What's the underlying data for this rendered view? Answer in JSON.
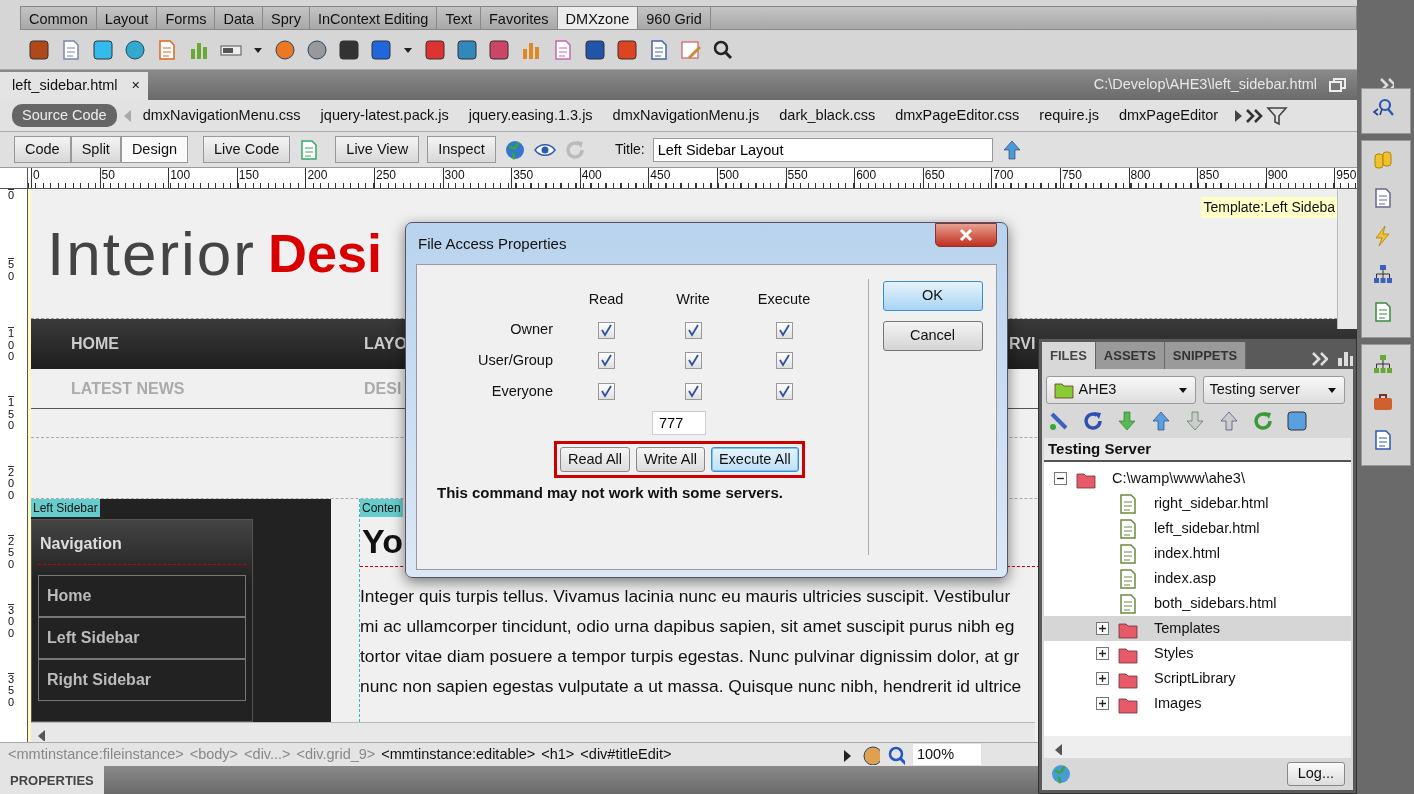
{
  "insert_tabs": [
    {
      "label": "Common",
      "selected": false
    },
    {
      "label": "Layout",
      "selected": false
    },
    {
      "label": "Forms",
      "selected": false
    },
    {
      "label": "Data",
      "selected": false
    },
    {
      "label": "Spry",
      "selected": false
    },
    {
      "label": "InContext Editing",
      "selected": false
    },
    {
      "label": "Text",
      "selected": false
    },
    {
      "label": "Favorites",
      "selected": false
    },
    {
      "label": "DMXzone",
      "selected": true
    },
    {
      "label": "960 Grid",
      "selected": false
    }
  ],
  "document_tab": {
    "label": "left_sidebar.html",
    "close": "×"
  },
  "document_path": "C:\\Develop\\AHE3\\left_sidebar.html",
  "related_files": [
    {
      "label": "Source Code",
      "selected": true
    },
    {
      "label": "dmxNavigationMenu.css",
      "selected": false
    },
    {
      "label": "jquery-latest.pack.js",
      "selected": false
    },
    {
      "label": "jquery.easing.1.3.js",
      "selected": false
    },
    {
      "label": "dmxNavigationMenu.js",
      "selected": false
    },
    {
      "label": "dark_black.css",
      "selected": false
    },
    {
      "label": "dmxPageEditor.css",
      "selected": false
    },
    {
      "label": "require.js",
      "selected": false
    },
    {
      "label": "dmxPageEditor",
      "selected": false
    }
  ],
  "view_buttons": [
    {
      "label": "Code",
      "selected": false
    },
    {
      "label": "Split",
      "selected": false
    },
    {
      "label": "Design",
      "selected": true
    }
  ],
  "live_code_button": "Live Code",
  "live_buttons": [
    "Live View",
    "Inspect"
  ],
  "title_field": {
    "label": "Title:",
    "value": "Left Sidebar Layout"
  },
  "horizontal_ruler": [
    "0",
    "50",
    "100",
    "150",
    "200",
    "250",
    "300",
    "350",
    "400",
    "450",
    "500",
    "550",
    "600",
    "650",
    "700",
    "750",
    "800",
    "850",
    "900",
    "950"
  ],
  "vertical_ruler": [
    "0",
    "50",
    "100",
    "150",
    "200",
    "250",
    "300",
    "350"
  ],
  "page": {
    "logo_light": "Interior",
    "logo_bold": "Desi",
    "template_label": "Template:Left Sideba",
    "nav": [
      "HOME",
      "LAYO",
      "RVI"
    ],
    "subnav": [
      "LATEST NEWS",
      "DESI"
    ],
    "sidebar_label": "Left Sidebar",
    "sidebar_title": "Navigation",
    "sidebar_links": [
      "Home",
      "Left Sidebar",
      "Right Sidebar"
    ],
    "content_label": "Conten",
    "heading": "Yo",
    "paragraph_lines": [
      "Integer quis turpis tellus. Vivamus lacinia nunc eu mauris ultricies suscipit. Vestibulur",
      "mi ac ullamcorper tincidunt, odio urna dapibus sapien, sit amet suscipit purus nibh eg",
      "tortor vitae diam posuere a tempor turpis egestas. Nunc pulvinar dignissim dolor, at gr",
      "nunc non sapien egestas vulputate a ut massa. Quisque nunc nibh, hendrerit id ultrice"
    ]
  },
  "tag_selector": [
    {
      "label": "<mmtinstance:fileinstance>",
      "dimmed": true
    },
    {
      "label": "<body>",
      "dimmed": true
    },
    {
      "label": "<div...>",
      "dimmed": true
    },
    {
      "label": "<div.grid_9>",
      "dimmed": true
    },
    {
      "label": "<mmtinstance:editable>",
      "dimmed": false
    },
    {
      "label": "<h1>",
      "dimmed": false
    },
    {
      "label": "<div#titleEdit>",
      "dimmed": false
    }
  ],
  "zoom": "100%",
  "properties_tab": "PROPERTIES",
  "dialog": {
    "title": "File Access Properties",
    "columns": [
      "Read",
      "Write",
      "Execute"
    ],
    "rows": [
      {
        "label": "Owner",
        "cells": [
          {
            "checked": true
          },
          {
            "checked": true
          },
          {
            "checked": true
          }
        ]
      },
      {
        "label": "User/Group",
        "cells": [
          {
            "checked": true
          },
          {
            "checked": true
          },
          {
            "checked": true
          }
        ]
      },
      {
        "label": "Everyone",
        "cells": [
          {
            "checked": true
          },
          {
            "checked": true
          },
          {
            "checked": true
          }
        ]
      }
    ],
    "octal": "777",
    "all_buttons": [
      {
        "label": "Read All",
        "focused": false
      },
      {
        "label": "Write All",
        "focused": false
      },
      {
        "label": "Execute All",
        "focused": true
      }
    ],
    "warning": "This command may not work with some servers.",
    "buttons": [
      {
        "label": "OK",
        "default": true
      },
      {
        "label": "Cancel",
        "default": false
      }
    ]
  },
  "files_panel": {
    "tabs": [
      {
        "label": "FILES",
        "selected": true
      },
      {
        "label": "ASSETS",
        "selected": false
      },
      {
        "label": "SNIPPETS",
        "selected": false
      }
    ],
    "site": "AHE3",
    "view": "Testing server",
    "header": "Testing Server",
    "tree": [
      {
        "label": "C:\\wamp\\www\\ahe3\\",
        "kind": "folder",
        "expanded": true,
        "selected": false,
        "children": [
          {
            "label": "right_sidebar.html",
            "kind": "file",
            "selected": false
          },
          {
            "label": "left_sidebar.html",
            "kind": "file",
            "selected": false
          },
          {
            "label": "index.html",
            "kind": "file",
            "selected": false
          },
          {
            "label": "index.asp",
            "kind": "file",
            "selected": false
          },
          {
            "label": "both_sidebars.html",
            "kind": "file",
            "selected": false
          },
          {
            "label": "Templates",
            "kind": "folder",
            "expanded": false,
            "selected": true
          },
          {
            "label": "Styles",
            "kind": "folder",
            "expanded": false,
            "selected": false
          },
          {
            "label": "ScriptLibrary",
            "kind": "folder",
            "expanded": false,
            "selected": false
          },
          {
            "label": "Images",
            "kind": "folder",
            "expanded": false,
            "selected": false
          }
        ]
      }
    ],
    "log_button": "Log..."
  }
}
